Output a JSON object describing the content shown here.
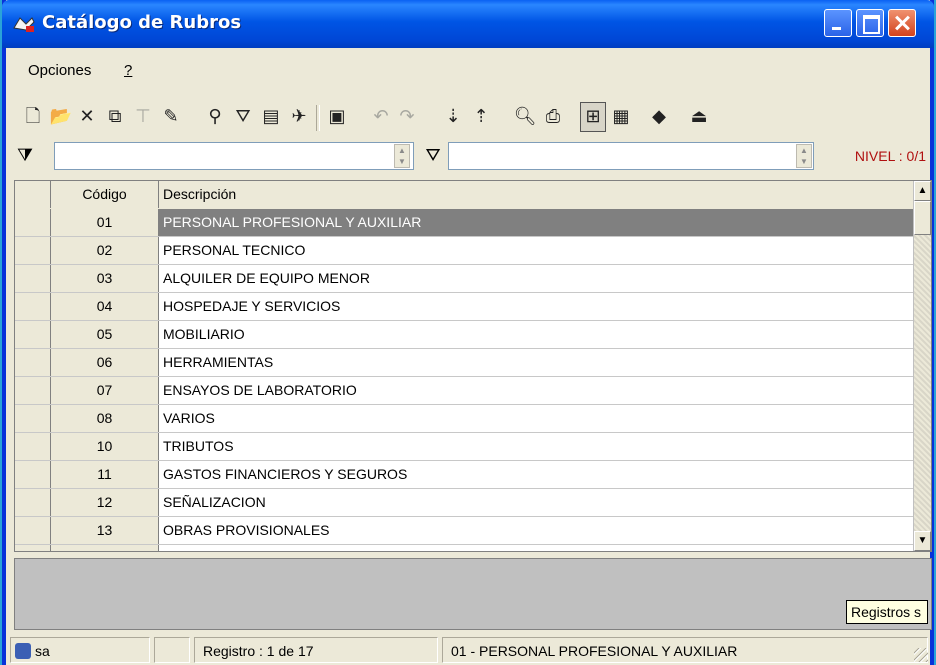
{
  "window": {
    "title": "Catálogo de Rubros"
  },
  "menu": {
    "opciones": "Opciones",
    "help": "?"
  },
  "toolbar": {
    "icons": [
      "new-icon",
      "open-icon",
      "delete-icon",
      "copy-icon",
      "tree-icon",
      "edit-icon",
      "find-icon",
      "filter-icon",
      "print-preview-icon",
      "export-icon",
      "import-icon",
      "undo-icon",
      "redo-icon",
      "sort-asc-icon",
      "sort-desc-icon",
      "preview-icon",
      "print-icon",
      "tree-view-icon",
      "grid-view-icon",
      "book-icon",
      "exit-icon"
    ]
  },
  "filter": {
    "left_value": "",
    "right_value": "",
    "nivel_label": "NIVEL : 0/1"
  },
  "grid": {
    "columns": [
      "Código",
      "Descripción"
    ],
    "rows": [
      {
        "code": "01",
        "desc": "PERSONAL PROFESIONAL Y AUXILIAR"
      },
      {
        "code": "02",
        "desc": "PERSONAL TECNICO"
      },
      {
        "code": "03",
        "desc": "ALQUILER DE EQUIPO MENOR"
      },
      {
        "code": "04",
        "desc": "HOSPEDAJE Y SERVICIOS"
      },
      {
        "code": "05",
        "desc": "MOBILIARIO"
      },
      {
        "code": "06",
        "desc": "HERRAMIENTAS"
      },
      {
        "code": "07",
        "desc": "ENSAYOS DE LABORATORIO"
      },
      {
        "code": "08",
        "desc": "VARIOS"
      },
      {
        "code": "10",
        "desc": "TRIBUTOS"
      },
      {
        "code": "11",
        "desc": "GASTOS FINANCIEROS Y SEGUROS"
      },
      {
        "code": "12",
        "desc": "SEÑALIZACION"
      },
      {
        "code": "13",
        "desc": "OBRAS PROVISIONALES"
      }
    ],
    "selected_index": 0
  },
  "tooltip": {
    "text": "Registros s"
  },
  "status": {
    "user": "sa",
    "empty": "",
    "registro": "Registro :   1 de  17",
    "current": "01 - PERSONAL PROFESIONAL Y AUXILIAR"
  },
  "colors": {
    "titlebar": "#0055e5",
    "selected_row": "#808080",
    "nivel": "#b01010"
  }
}
